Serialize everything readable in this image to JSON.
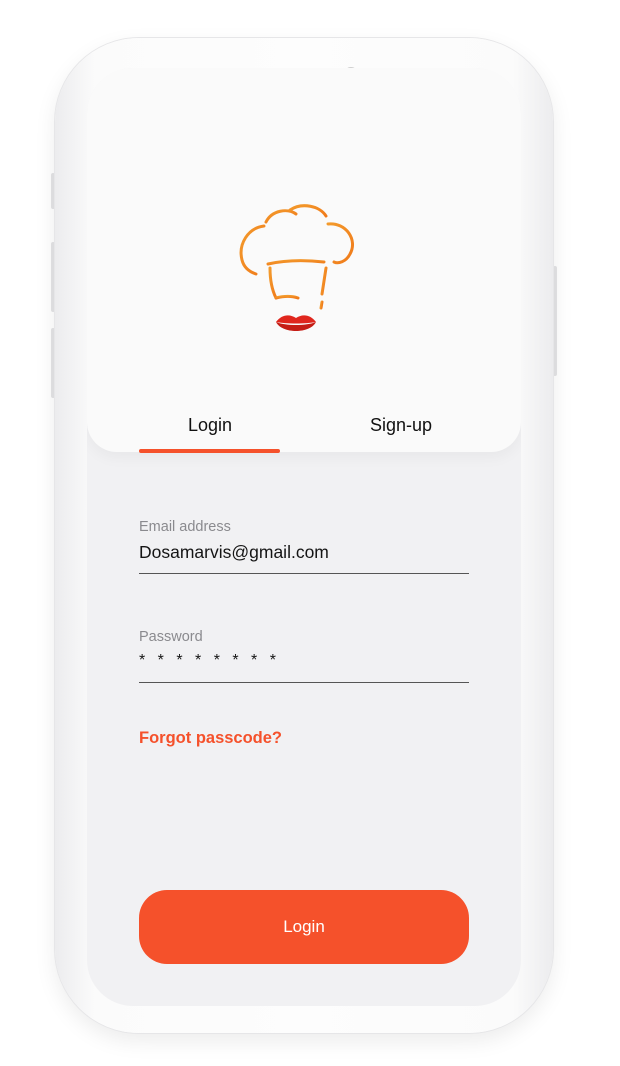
{
  "app": {
    "logo_icon": "chef-hat-lips-logo-icon",
    "accent_color": "#f5512b",
    "lips_color": "#e0261d"
  },
  "tabs": [
    {
      "label": "Login",
      "active": true
    },
    {
      "label": "Sign-up",
      "active": false
    }
  ],
  "form": {
    "email": {
      "label": "Email address",
      "value": "Dosamarvis@gmail.com"
    },
    "password": {
      "label": "Password",
      "value": "********"
    },
    "forgot_label": "Forgot passcode?",
    "submit_label": "Login"
  }
}
